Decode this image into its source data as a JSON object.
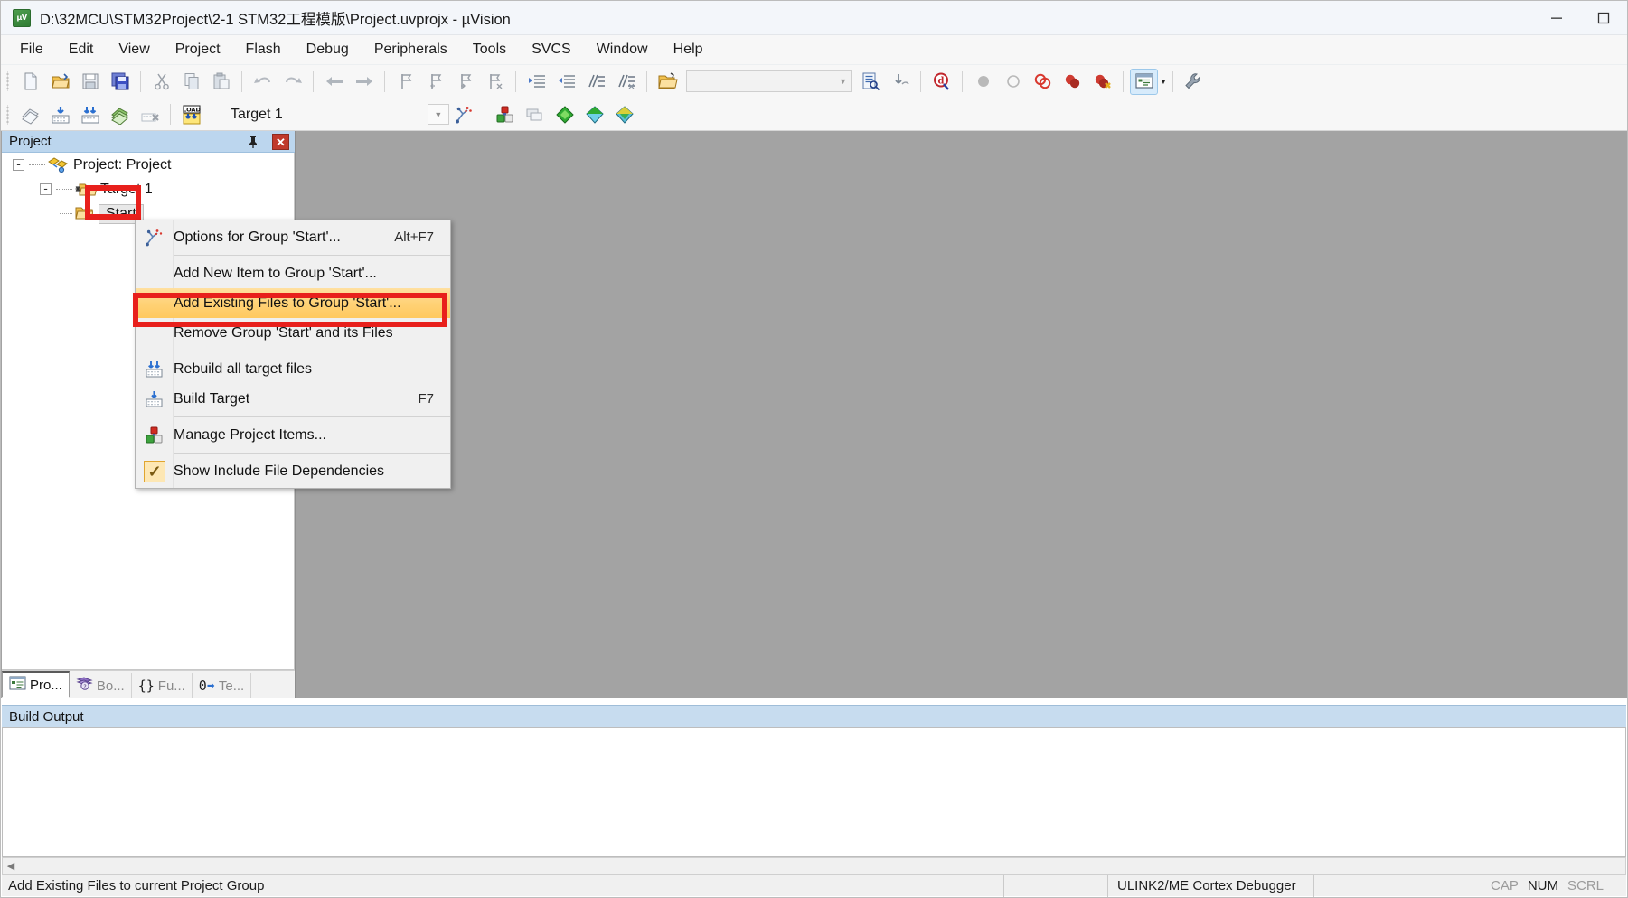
{
  "window": {
    "title": "D:\\32MCU\\STM32Project\\2-1 STM32工程模版\\Project.uvprojx - µVision",
    "app_icon": "uvision-icon",
    "minimize": "minimize-icon",
    "maximize": "maximize-icon"
  },
  "menubar": {
    "items": [
      {
        "label": "File"
      },
      {
        "label": "Edit"
      },
      {
        "label": "View"
      },
      {
        "label": "Project"
      },
      {
        "label": "Flash"
      },
      {
        "label": "Debug"
      },
      {
        "label": "Peripherals"
      },
      {
        "label": "Tools"
      },
      {
        "label": "SVCS"
      },
      {
        "label": "Window"
      },
      {
        "label": "Help"
      }
    ]
  },
  "toolbar_row1": {
    "buttons": [
      {
        "name": "new-file-icon"
      },
      {
        "name": "open-file-icon"
      },
      {
        "name": "save-icon"
      },
      {
        "name": "save-all-icon"
      },
      {
        "name": "cut-icon"
      },
      {
        "name": "copy-icon"
      },
      {
        "name": "paste-icon"
      },
      {
        "name": "undo-icon"
      },
      {
        "name": "redo-icon"
      },
      {
        "name": "navigate-back-icon"
      },
      {
        "name": "navigate-forward-icon"
      },
      {
        "name": "bookmark-toggle-icon"
      },
      {
        "name": "bookmark-prev-icon"
      },
      {
        "name": "bookmark-next-icon"
      },
      {
        "name": "bookmark-clear-icon"
      },
      {
        "name": "indent-icon"
      },
      {
        "name": "outdent-icon"
      },
      {
        "name": "comment-icon"
      },
      {
        "name": "uncomment-icon"
      },
      {
        "name": "open-folder-icon"
      }
    ],
    "search_box": {
      "value": "",
      "placeholder": ""
    },
    "after_search": [
      {
        "name": "find-in-files-icon"
      },
      {
        "name": "incremental-find-icon"
      },
      {
        "name": "debug-search-icon"
      },
      {
        "name": "insert-breakpoint-icon"
      },
      {
        "name": "disable-breakpoint-icon"
      },
      {
        "name": "kill-all-breakpoints-icon"
      },
      {
        "name": "disable-all-breakpoints-icon"
      }
    ],
    "window_button": {
      "name": "manage-windows-icon",
      "active": true
    },
    "config_button": {
      "name": "configure-icon"
    }
  },
  "toolbar_row2": {
    "buttons": [
      {
        "name": "translate-icon"
      },
      {
        "name": "build-icon"
      },
      {
        "name": "rebuild-icon"
      },
      {
        "name": "batch-build-icon"
      },
      {
        "name": "stop-build-icon"
      },
      {
        "name": "download-icon"
      }
    ],
    "target_label": "Target 1",
    "target_dropdown": "chevron-down-icon",
    "after_target": [
      {
        "name": "target-options-icon"
      },
      {
        "name": "manage-project-items-icon"
      },
      {
        "name": "manage-multi-project-icon"
      },
      {
        "name": "manage-run-time-env-icon"
      },
      {
        "name": "pack-installer-icon"
      },
      {
        "name": "manage-components-icon"
      }
    ]
  },
  "project_panel": {
    "header": "Project",
    "pin_icon": "pin-icon",
    "close_icon": "close-icon",
    "tree": [
      {
        "label": "Project: Project",
        "level": 0,
        "icon": "project-icon",
        "expander": "-"
      },
      {
        "label": "Target 1",
        "level": 1,
        "icon": "target-folder-icon",
        "expander": "-"
      },
      {
        "label": "Start",
        "level": 2,
        "icon": "group-folder-icon",
        "selected": true
      }
    ],
    "tabs": [
      {
        "label": "Pro...",
        "icon": "project-window-icon",
        "active": true
      },
      {
        "label": "Bo...",
        "icon": "books-icon",
        "active": false
      },
      {
        "label": "Fu...",
        "icon": "functions-icon",
        "active": false
      },
      {
        "label": "Te...",
        "icon": "templates-icon",
        "active": false
      }
    ]
  },
  "context_menu": {
    "items": [
      {
        "label": "Options for Group 'Start'...",
        "accel": "Alt+F7",
        "icon": "options-wand-icon",
        "sep_after": true
      },
      {
        "label": "Add New  Item to Group 'Start'...",
        "accel": "",
        "icon": "",
        "sep_after": false
      },
      {
        "label": "Add Existing Files to Group 'Start'...",
        "accel": "",
        "icon": "",
        "highlight": true,
        "sep_after": false
      },
      {
        "label": "Remove Group 'Start' and its Files",
        "accel": "",
        "icon": "",
        "sep_after": true
      },
      {
        "label": "Rebuild all target files",
        "accel": "",
        "icon": "rebuild-icon",
        "sep_after": false
      },
      {
        "label": "Build Target",
        "accel": "F7",
        "icon": "build-icon",
        "sep_after": true
      },
      {
        "label": "Manage Project Items...",
        "accel": "",
        "icon": "manage-project-items-icon",
        "sep_after": true
      },
      {
        "label": "Show Include File Dependencies",
        "accel": "",
        "icon": "checkmark-icon",
        "checked": true,
        "sep_after": false
      }
    ]
  },
  "build_output": {
    "header": "Build Output",
    "content": ""
  },
  "statusbar": {
    "message": "Add Existing Files to current Project Group",
    "debugger": "ULINK2/ME Cortex Debugger",
    "cell_a": "",
    "cell_b": "",
    "indicators": [
      {
        "label": "CAP",
        "on": false
      },
      {
        "label": "NUM",
        "on": true
      },
      {
        "label": "SCRL",
        "on": false
      }
    ]
  },
  "colors": {
    "panel_header": "#bcd6ee",
    "build_header": "#c7dcef",
    "highlight_row": "#ffd277",
    "red_annotation": "#e8201c",
    "workspace": "#a3a3a3",
    "toolbar_bg": "#f7f7f7",
    "active_button": "#d7ebfb"
  }
}
